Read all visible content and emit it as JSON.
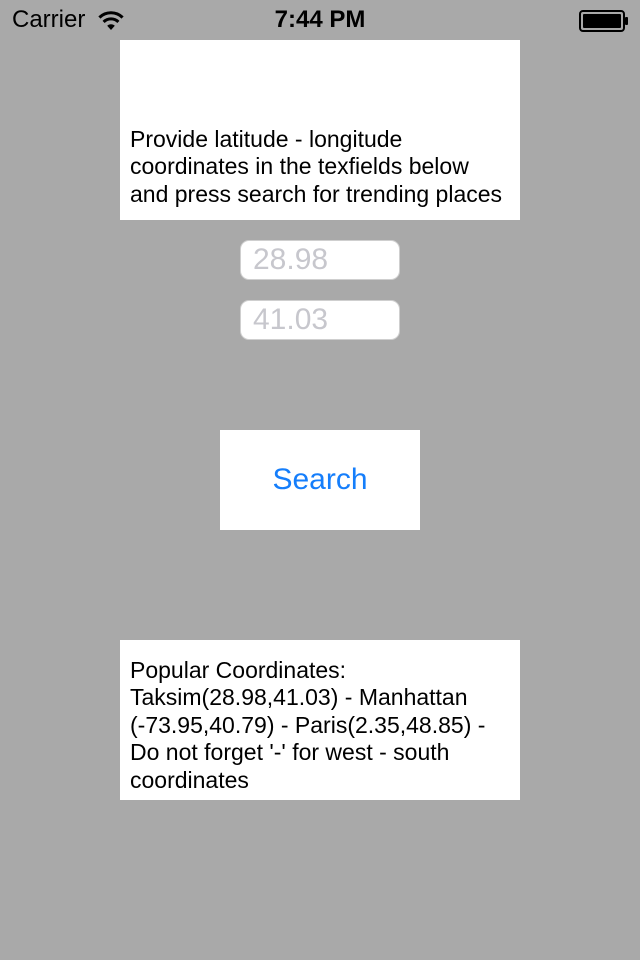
{
  "status_bar": {
    "carrier": "Carrier",
    "time": "7:44 PM",
    "wifi_icon": "wifi-icon",
    "battery_icon": "battery-icon"
  },
  "instructions": {
    "text": "Provide latitude - longitude coordinates in the texfields below and press search for trending places"
  },
  "latitude_field": {
    "value": "",
    "placeholder": "28.98"
  },
  "longitude_field": {
    "value": "",
    "placeholder": "41.03"
  },
  "search_button": {
    "label": "Search"
  },
  "popular": {
    "text": "Popular Coordinates: Taksim(28.98,41.03) - Manhattan (-73.95,40.79) - Paris(2.35,48.85) - Do not forget '-' for west - south coordinates"
  },
  "colors": {
    "background": "#a9a9a9",
    "accent": "#157efb",
    "placeholder": "#c7c7cd"
  }
}
